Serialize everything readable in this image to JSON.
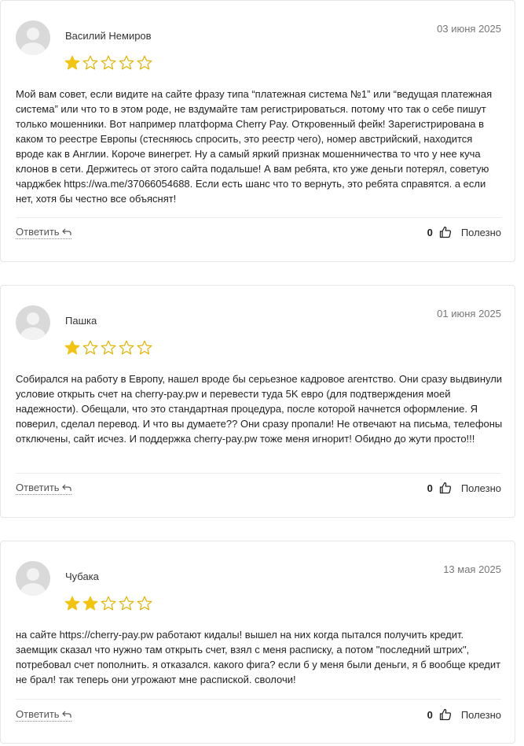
{
  "reviews": [
    {
      "author": "Василий Немиров",
      "date": "03 июня 2025",
      "rating": 1,
      "text_before_link": "Мой вам совет, если видите на сайте фразу типа “платежная система №1” или “ведущая платежная система” или что то в этом роде, не вздумайте там регистрироваться. потому что так о себе пишут только мошенники. Вот например платформа Cherry Pay. Откровенный фейк! Зарегистрирована в каком то реестре Европы (стесняюсь спросить, это реестр чего), номер австрийский, находится вроде как в Англии. Короче винегрет. Ну а самый яркий признак мошенничества то что у нее куча клонов в сети. Держитесь от этого сайта подальше! А вам ребята, кто уже деньги потерял, советую чарджбек ",
      "link": "https://wa.me/37066054688",
      "text_after_link": ". Если есть шанс что то вернуть, это ребята справятся. а если нет, хотя бы честно все объяснят!",
      "reply_label": "Ответить",
      "likes": "0",
      "useful_label": "Полезно"
    },
    {
      "author": "Пашка",
      "date": "01 июня 2025",
      "rating": 1,
      "text": "Собирался на работу в Европу, нашел вроде бы серьезное кадровое агентство. Они сразу выдвинули условие открыть счет на cherry-pay.pw и перевести туда 5K евро (для подтверждения моей надежности). Обещали, что это стандартная процедура, после которой начнется оформление. Я поверил, сделал перевод. И что вы думаете?? Они сразу пропали! Не отвечают на письма, телефоны отключены, сайт исчез. И поддержка cherry-pay.pw тоже меня игнорит! Обидно до жути просто!!!",
      "reply_label": "Ответить",
      "likes": "0",
      "useful_label": "Полезно"
    },
    {
      "author": "Чубака",
      "date": "13 мая 2025",
      "rating": 2,
      "text": "на сайте https://cherry-pay.pw работают кидалы! вышел на них когда пытался получить кредит. заемщик сказал что нужно там открыть счет, взял с меня расписку, а потом \"последний штрих\", потребовал счет пополнить. я отказался. какого фига? если б у меня были деньги, я б вообще кредит не брал! так теперь они угрожают мне распиской. сволочи!",
      "reply_label": "Ответить",
      "likes": "0",
      "useful_label": "Полезно"
    }
  ],
  "colors": {
    "star_filled": "#f2c311",
    "star_empty_stroke": "#e0b400"
  },
  "icons": {
    "reply": "reply-arrow-icon",
    "like": "thumbs-up-icon",
    "avatar": "user-avatar-icon",
    "star": "star-icon"
  }
}
